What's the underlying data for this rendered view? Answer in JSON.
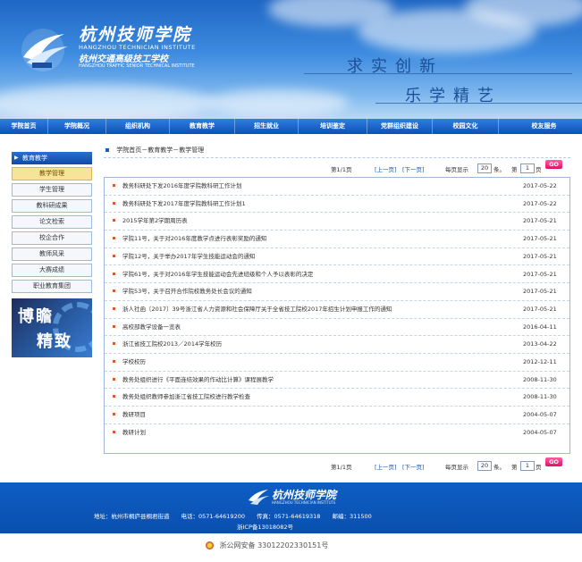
{
  "header": {
    "school_name": "杭州技师学院",
    "school_name_en": "HANGZHOU TECHNICIAN INSTITUTE",
    "sub_name": "杭州交通高级技工学校",
    "sub_name_en": "HANGZHOU TRAFFIC SENIOR TECHNICAL INSTITUTE",
    "motto1": "求实创新",
    "motto2": "乐学精艺"
  },
  "nav": [
    {
      "label": "学院首页",
      "w": 53
    },
    {
      "label": "学院概况",
      "w": 64
    },
    {
      "label": "组织机构",
      "w": 70
    },
    {
      "label": "教育教学",
      "w": 72
    },
    {
      "label": "招生就业",
      "w": 70
    },
    {
      "label": "培训鉴定",
      "w": 76
    },
    {
      "label": "党群组织建设",
      "w": 72
    },
    {
      "label": "校园文化",
      "w": 73
    },
    {
      "label": "校友服务",
      "w": 101
    }
  ],
  "sidebar": {
    "header": "教育教学",
    "items": [
      "教学管理",
      "学生管理",
      "教科研成果",
      "论文检索",
      "校企合作",
      "教师风采",
      "大赛成绩",
      "职业教育集团"
    ],
    "active_index": 0,
    "promo_line1": "博瞻",
    "promo_line2": "精致"
  },
  "breadcrumb": "学院首页－教育教学－教学管理",
  "pager": {
    "page_info": "第1/1页",
    "prev": "[上一页]",
    "next": "[下一页]",
    "per_page_label": "每页显示",
    "per_page_value": "20",
    "per_page_unit": "条。",
    "goto_label": "第",
    "goto_value": "1",
    "goto_unit": "页",
    "go": "GO"
  },
  "articles": [
    {
      "title": "教务科研处下发2016年度学院教科研工作计划",
      "date": "2017-05-22"
    },
    {
      "title": "教务科研处下发2017年度学院教科研工作计划1",
      "date": "2017-05-22"
    },
    {
      "title": "2015学年第2学期周历表",
      "date": "2017-05-21"
    },
    {
      "title": "学院11号，关于对2016年度教学点进行表彰奖励的通知",
      "date": "2017-05-21"
    },
    {
      "title": "学院12号，关于举办2017年学生技能运动会的通知",
      "date": "2017-05-21"
    },
    {
      "title": "学院61号，关于对2016年学生技能运动会先进班级和个人予以表彰的决定",
      "date": "2017-05-21"
    },
    {
      "title": "学院53号，关于召开合作院校教务处长会议的通知",
      "date": "2017-05-21"
    },
    {
      "title": "浙人社函〔2017〕39号浙江省人力资源和社会保障厅关于全省技工院校2017年招生计划申报工作的通知",
      "date": "2017-05-21"
    },
    {
      "title": "高校部教学设备一览表",
      "date": "2016-04-11"
    },
    {
      "title": "浙江省技工院校2013／2014学年校历",
      "date": "2013-04-22"
    },
    {
      "title": "学校校历",
      "date": "2012-12-11"
    },
    {
      "title": "教务处组织进行《平面连结效果的作动比计算》课程展教学",
      "date": "2008-11-30"
    },
    {
      "title": "教务处组织教师参加浙江省技工院校进行教学检查",
      "date": "2008-11-30"
    },
    {
      "title": "教研项目",
      "date": "2004-05-07"
    },
    {
      "title": "教研计划",
      "date": "2004-05-07"
    }
  ],
  "footer": {
    "logo_text": "杭州技师学院",
    "logo_en": "HANGZHOU TECHNICIAN INSTITUTE",
    "info": "地址：杭州市桐庐县桐君街道　　电话：0571-64619200　　传真：0571-64619318　　邮编：311500",
    "icp": "浙ICP备13018082号",
    "beian": "浙公网安备 33012202330151号"
  },
  "colors": {
    "nav": "#0d4fb8",
    "accent": "#1f5fb8",
    "go_button": "#d81467",
    "bullet": "#e05a2b"
  }
}
